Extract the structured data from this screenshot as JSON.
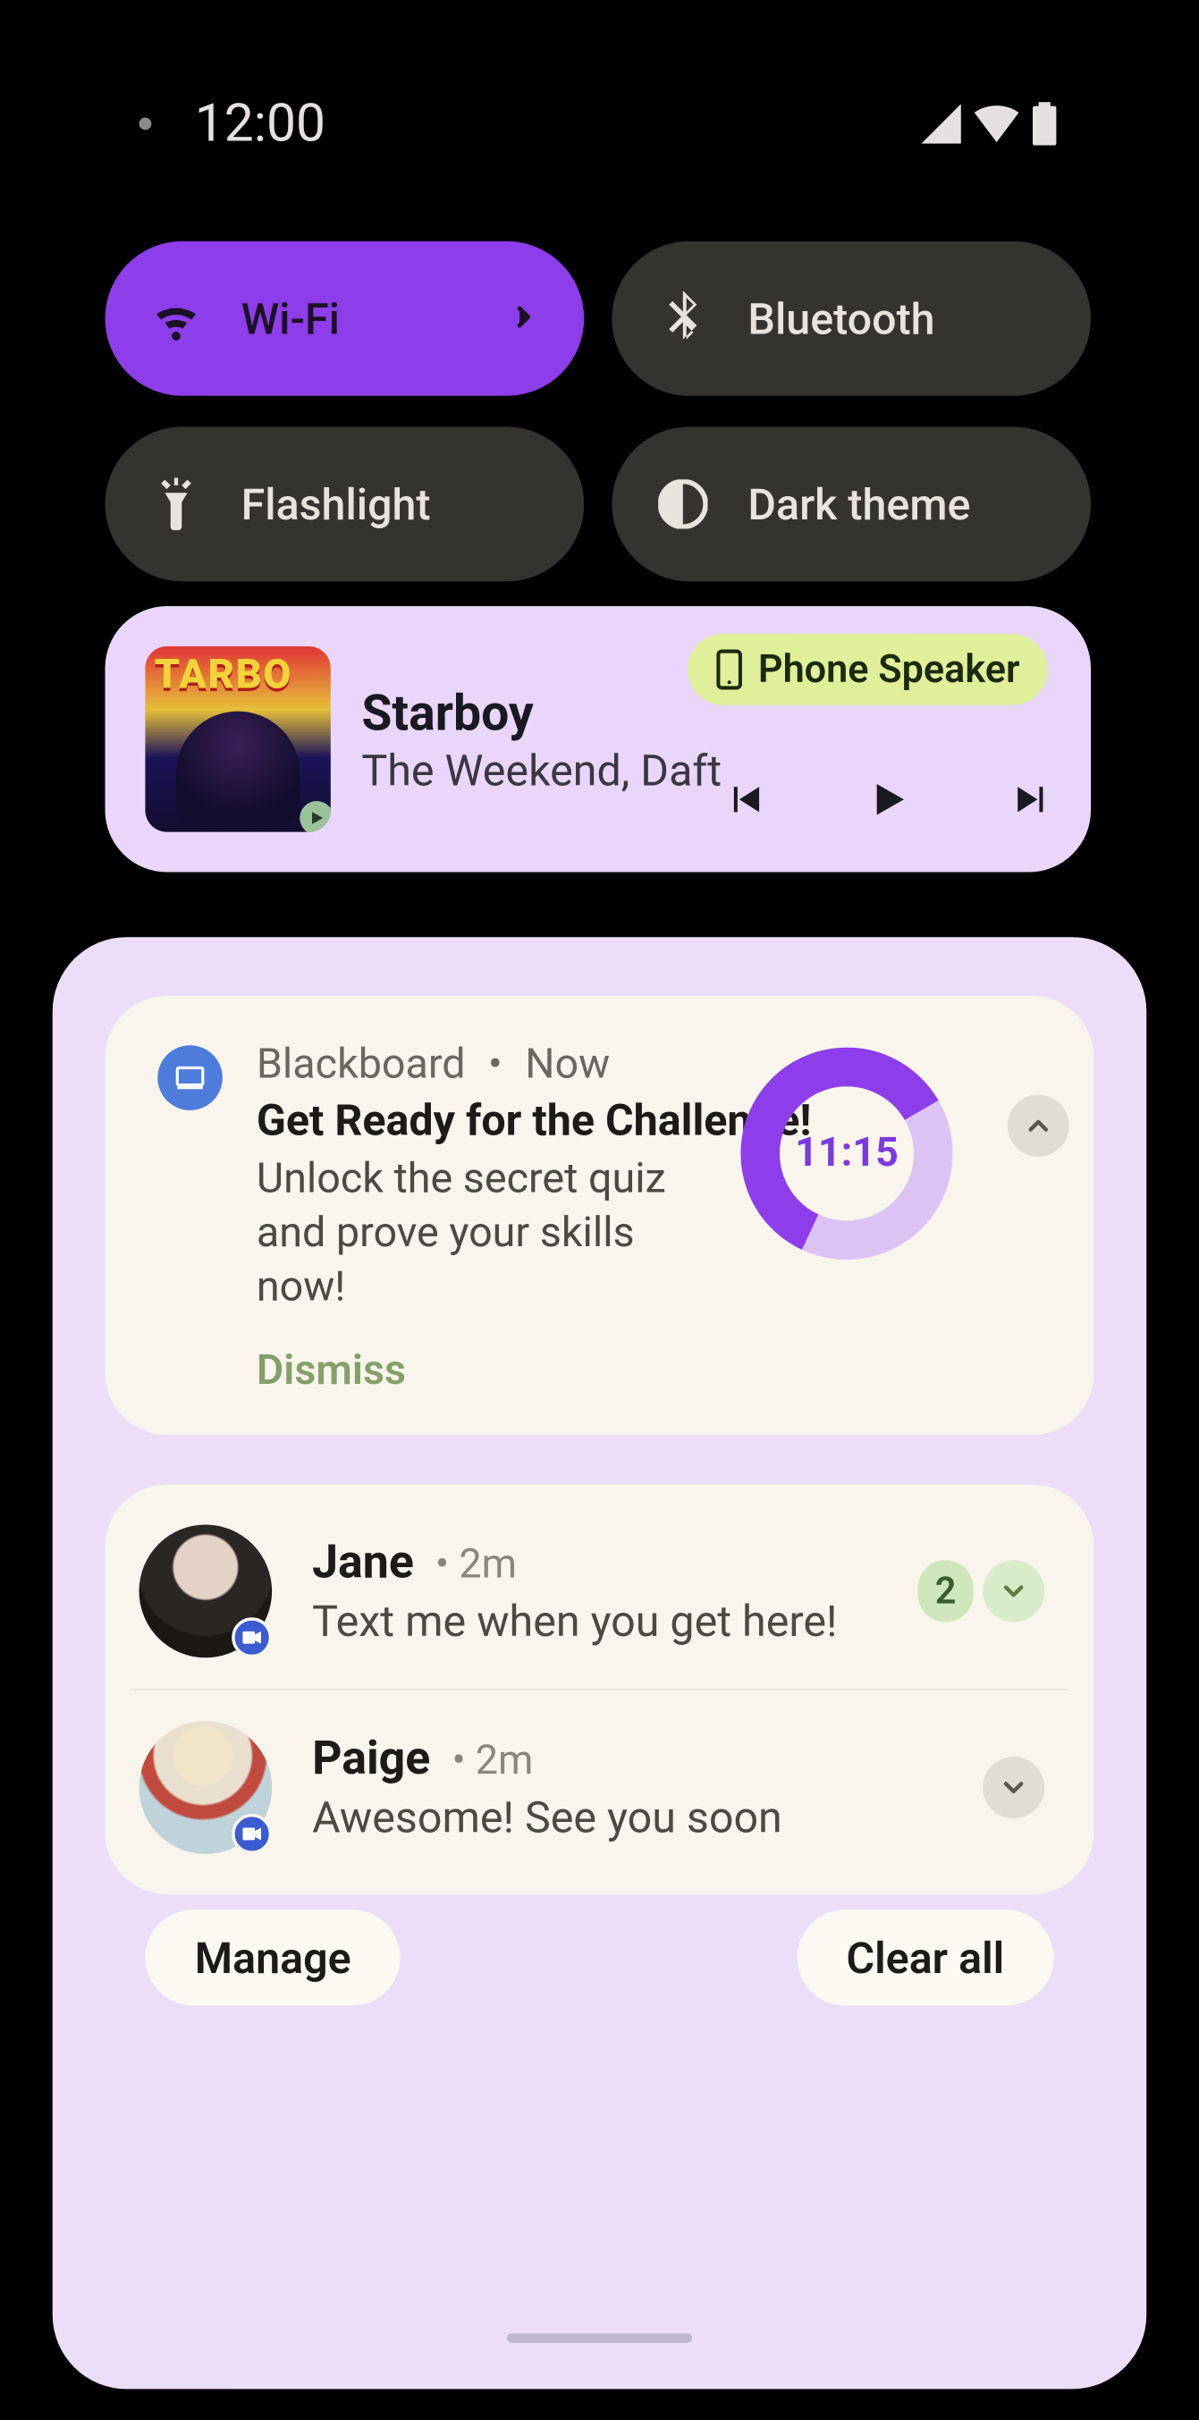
{
  "statusbar": {
    "time": "12:00"
  },
  "tiles": {
    "wifi": "Wi-Fi",
    "bluetooth": "Bluetooth",
    "flashlight": "Flashlight",
    "darktheme": "Dark theme"
  },
  "media": {
    "title": "Starboy",
    "artist": "The Weekend, Daft",
    "output": "Phone Speaker",
    "album_text": "TARBO"
  },
  "notif1": {
    "app": "Blackboard",
    "time": "Now",
    "title": "Get Ready for the Challenge!",
    "body": "Unlock the secret quiz and prove your skills now!",
    "dismiss": "Dismiss",
    "timer": "11:15"
  },
  "convo": {
    "jane": {
      "name": "Jane",
      "time": "2m",
      "preview": "Text me when you get here!",
      "count": "2"
    },
    "paige": {
      "name": "Paige",
      "time": "2m",
      "preview": "Awesome! See you soon"
    }
  },
  "footer": {
    "manage": "Manage",
    "clear": "Clear all"
  }
}
